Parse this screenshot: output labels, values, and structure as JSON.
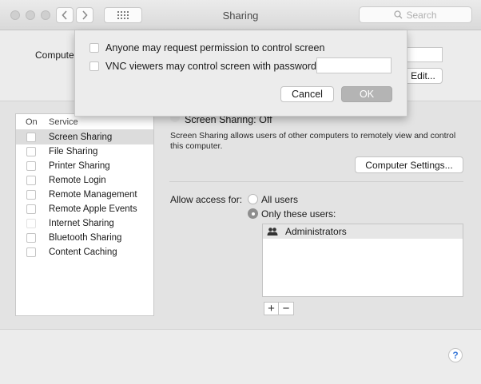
{
  "window": {
    "title": "Sharing"
  },
  "toolbar": {
    "back_icon": "chevron-left-icon",
    "forward_icon": "chevron-right-icon",
    "grid_icon": "grid-icon",
    "search_placeholder": "Search",
    "search_icon": "magnifier-icon"
  },
  "computer": {
    "label": "Compute",
    "edit_label": "Edit..."
  },
  "services": {
    "header_on": "On",
    "header_service": "Service",
    "items": [
      {
        "label": "Screen Sharing",
        "selected": true
      },
      {
        "label": "File Sharing"
      },
      {
        "label": "Printer Sharing"
      },
      {
        "label": "Remote Login"
      },
      {
        "label": "Remote Management"
      },
      {
        "label": "Remote Apple Events"
      },
      {
        "label": "Internet Sharing"
      },
      {
        "label": "Bluetooth Sharing"
      },
      {
        "label": "Content Caching"
      }
    ]
  },
  "detail": {
    "status": "Screen Sharing: Off",
    "description": "Screen Sharing allows users of other computers to remotely view and control this computer.",
    "settings_button": "Computer Settings...",
    "allow_label": "Allow access for:",
    "option_all": "All users",
    "option_only": "Only these users:",
    "users": [
      {
        "name": "Administrators",
        "icon": "group-icon"
      }
    ],
    "add_label": "+",
    "remove_label": "−"
  },
  "sheet": {
    "option_request": "Anyone may request permission to control screen",
    "option_vnc": "VNC viewers may control screen with password:",
    "cancel_label": "Cancel",
    "ok_label": "OK"
  },
  "help": {
    "label": "?"
  },
  "colors": {
    "accent": "#3c7bd9",
    "window_bg": "#ececec",
    "ok_button": "#b4b4b4"
  }
}
